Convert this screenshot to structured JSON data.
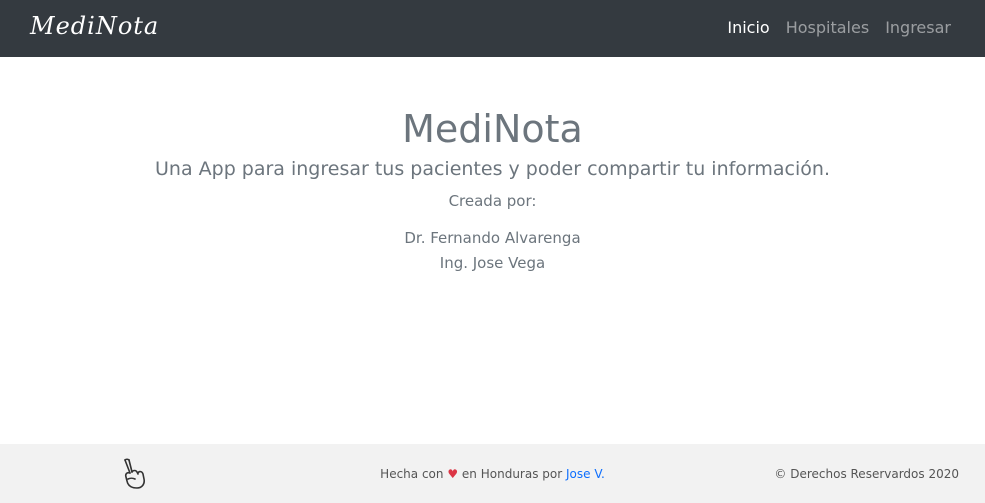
{
  "navbar": {
    "brand": "MediNota",
    "links": [
      {
        "label": "Inicio",
        "active": true
      },
      {
        "label": "Hospitales",
        "active": false
      },
      {
        "label": "Ingresar",
        "active": false
      }
    ]
  },
  "hero": {
    "title": "MediNota",
    "lead": "Una App para ingresar tus pacientes y poder compartir tu información.",
    "created_label": "Creada por:",
    "authors": [
      "Dr. Fernando Alvarenga",
      "Ing. Jose Vega"
    ]
  },
  "footer": {
    "icon": "peace-hand-icon",
    "made_with_prefix": "Hecha con",
    "heart": "♥",
    "made_with_suffix": "en Honduras por",
    "author_link": "Jose V.",
    "copyright": "© Derechos Reservardos 2020"
  },
  "colors": {
    "navbar_bg": "#343a40",
    "text_muted": "#6c757d",
    "footer_bg": "#f2f2f2",
    "heart": "#dc3545",
    "link": "#0d6efd"
  }
}
